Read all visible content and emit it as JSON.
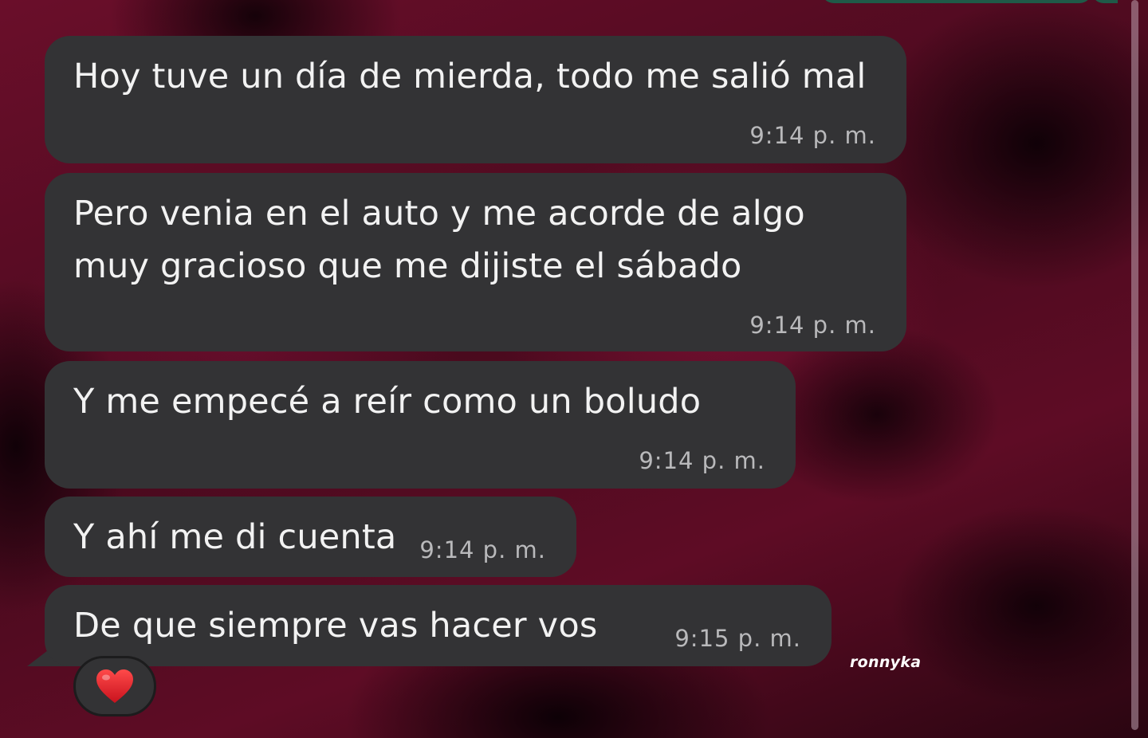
{
  "messages": [
    {
      "text": "Hoy tuve un día de mierda, todo me salió mal",
      "time": "9:14 p. m."
    },
    {
      "text": "Pero venia en el auto y me acorde de algo\nmuy gracioso que me dijiste el sábado",
      "time": "9:14 p. m."
    },
    {
      "text": "Y me empecé a reír como un boludo",
      "time": "9:14 p. m."
    },
    {
      "text": "Y ahí me di cuenta",
      "time": "9:14 p. m."
    },
    {
      "text": "De que siempre vas hacer vos",
      "time": "9:15 p. m."
    }
  ],
  "reaction": {
    "emoji": "heart-icon",
    "color": "#e0242f"
  },
  "watermark": "ronnyka",
  "colors": {
    "bubble": "#333335",
    "text": "#f2f2f2",
    "time": "#b9b9bb",
    "sent_bubble": "#1f5a48"
  }
}
